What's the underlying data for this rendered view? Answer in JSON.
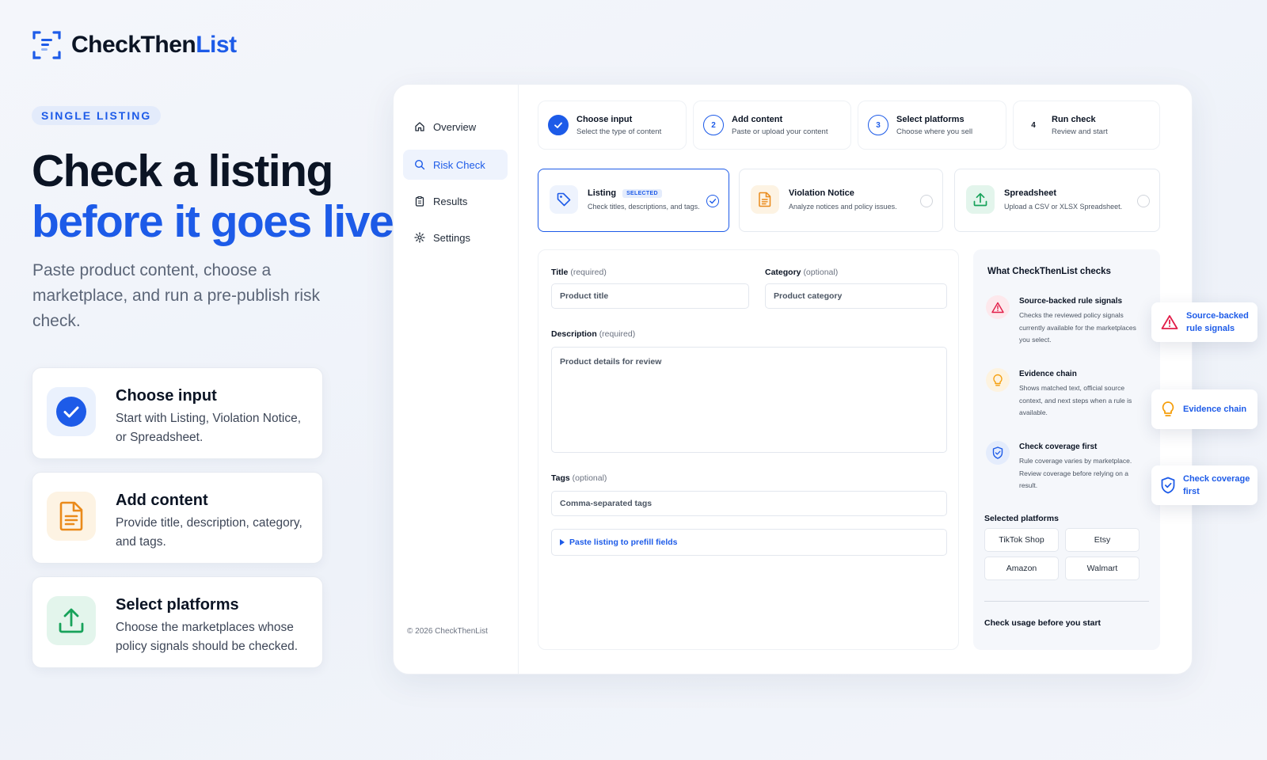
{
  "brand": {
    "name_part1": "CheckThen",
    "name_part2": "List"
  },
  "hero": {
    "tag": "SINGLE LISTING",
    "title_line1": "Check a listing",
    "title_line2": "before it goes live",
    "subtitle": "Paste product content, choose a marketplace, and run a pre-publish risk check."
  },
  "features": [
    {
      "title": "Choose input",
      "desc": "Start with Listing, Violation Notice, or Spreadsheet."
    },
    {
      "title": "Add content",
      "desc": "Provide title, description, category, and tags."
    },
    {
      "title": "Select platforms",
      "desc": "Choose the marketplaces whose policy signals should be checked."
    }
  ],
  "sidebar": {
    "items": [
      {
        "label": "Overview"
      },
      {
        "label": "Risk Check"
      },
      {
        "label": "Results"
      },
      {
        "label": "Settings"
      }
    ],
    "copyright": "© 2026 CheckThenList"
  },
  "steps": [
    {
      "num": "✓",
      "title": "Choose input",
      "desc": "Select the type of content"
    },
    {
      "num": "2",
      "title": "Add content",
      "desc": "Paste or upload your content"
    },
    {
      "num": "3",
      "title": "Select platforms",
      "desc": "Choose where you sell"
    },
    {
      "num": "4",
      "title": "Run check",
      "desc": "Review and start"
    }
  ],
  "input_types": [
    {
      "title": "Listing",
      "badge": "SELECTED",
      "desc": "Check titles, descriptions, and tags."
    },
    {
      "title": "Violation Notice",
      "desc": "Analyze notices and policy issues."
    },
    {
      "title": "Spreadsheet",
      "desc": "Upload a CSV or XLSX Spreadsheet."
    }
  ],
  "form": {
    "title_label": "Title",
    "title_hint": "(required)",
    "title_placeholder": "Product title",
    "category_label": "Category",
    "category_hint": "(optional)",
    "category_placeholder": "Product category",
    "description_label": "Description",
    "description_hint": "(required)",
    "description_placeholder": "Product details for review",
    "tags_label": "Tags",
    "tags_hint": "(optional)",
    "tags_placeholder": "Comma-separated tags",
    "paste_link": "Paste listing to prefill fields"
  },
  "checks": {
    "title": "What CheckThenList checks",
    "items": [
      {
        "title": "Source-backed rule signals",
        "desc": "Checks the reviewed policy signals currently available for the marketplaces you select."
      },
      {
        "title": "Evidence chain",
        "desc": "Shows matched text, official source context, and next steps when a rule is available."
      },
      {
        "title": "Check coverage first",
        "desc": "Rule coverage varies by marketplace. Review coverage before relying on a result."
      }
    ],
    "platforms_title": "Selected platforms",
    "platforms": [
      "TikTok Shop",
      "Etsy",
      "Amazon",
      "Walmart"
    ],
    "usage": "Check usage before you start"
  },
  "floating": [
    {
      "label": "Source-backed rule signals"
    },
    {
      "label": "Evidence chain"
    },
    {
      "label": "Check coverage first"
    }
  ],
  "colors": {
    "accent": "#1d5be8",
    "warning": "#e11d48",
    "amber": "#f59e0b",
    "green": "#16a34a"
  }
}
